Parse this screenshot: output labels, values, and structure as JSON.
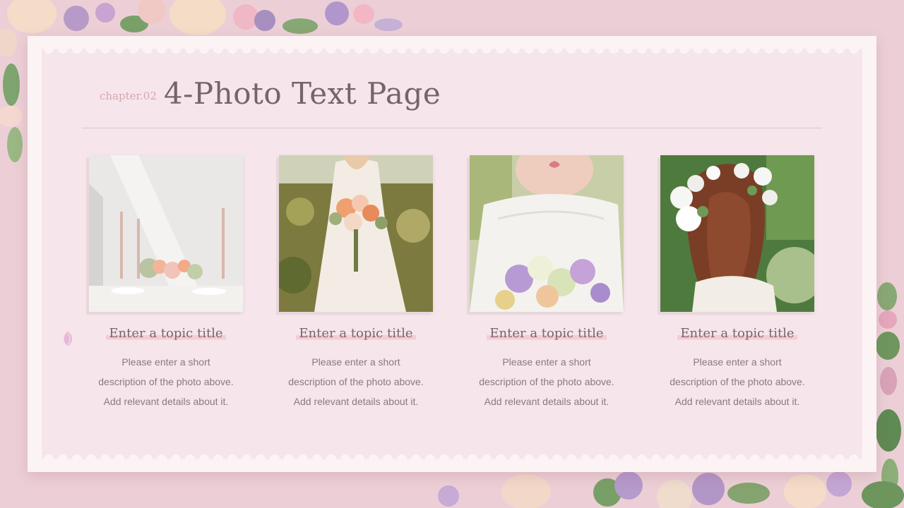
{
  "header": {
    "chapter": "chapter.02",
    "title": "4-Photo Text Page"
  },
  "photos": [
    {
      "title": "Enter a topic title",
      "lines": [
        "Please enter a short",
        "description of the photo above.",
        "Add relevant details about it."
      ]
    },
    {
      "title": "Enter a topic title",
      "lines": [
        "Please enter a short",
        "description of the photo above.",
        "Add relevant details about it."
      ]
    },
    {
      "title": "Enter a topic title",
      "lines": [
        "Please enter a short",
        "description of the photo above.",
        "Add relevant details about it."
      ]
    },
    {
      "title": "Enter a topic title",
      "lines": [
        "Please enter a short",
        "description of the photo above.",
        "Add relevant details about it."
      ]
    }
  ],
  "colors": {
    "background": "#eccfd6",
    "card": "#fcf3f5",
    "stamp": "#f6e6eb",
    "title": "#756468",
    "chapter": "#d4a6ae",
    "highlight": "#f5ccd4"
  }
}
